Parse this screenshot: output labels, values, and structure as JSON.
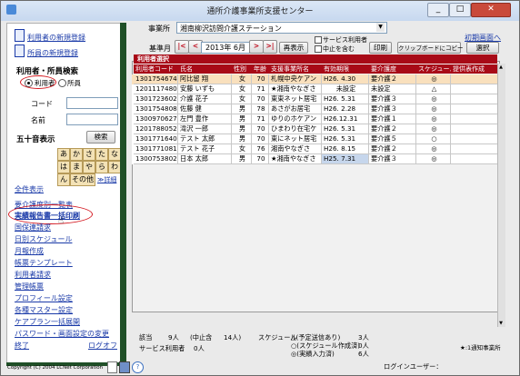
{
  "window": {
    "title": "通所介護事業所支援センター"
  },
  "sidebar": {
    "links": [
      {
        "label": "利用者の新規登録"
      },
      {
        "label": "所員の新規登録"
      }
    ],
    "search_title": "利用者・所員検索",
    "radio_user": "利用者",
    "radio_staff": "所員",
    "code_label": "コード",
    "name_label": "名前",
    "fifty_title": "五十音表示",
    "search_button": "検索",
    "kana": [
      "あ",
      "か",
      "さ",
      "た",
      "な",
      "は",
      "ま",
      "や",
      "ら",
      "わ",
      "ん",
      "その他"
    ],
    "detail_link": "≫詳細",
    "menu": [
      "全件表示",
      "要介護度別一覧表",
      "実績報告書一括印刷",
      "国保連請求",
      "日別スケジュール",
      "月報作成",
      "帳票テンプレート",
      "利用者請求",
      "管理帳票",
      "プロフィール設定",
      "各種マスター設定",
      "ケアプラン一括展開",
      "パスワード・画面設定の変更"
    ],
    "exit": "終了",
    "logout": "ログオフ",
    "copyright": "Copyright (C) 2004 LCNet Corporation"
  },
  "toolbar": {
    "office_label": "事業所",
    "office_value": "湘南柳沢訪問介護ステーション",
    "init_link": "初期画面へ",
    "base_month_label": "基準月",
    "year_month": "2013年 6月",
    "nav_first": "|<",
    "nav_prev": "<",
    "nav_next": ">",
    "nav_last": ">|",
    "reshow": "再表示",
    "service_user": "サービス利用者",
    "include_stop": "中止を含む",
    "print": "印刷",
    "clipboard": "クリップボードにコピー",
    "select": "選択"
  },
  "grid": {
    "title": "利用者選択",
    "columns": [
      "利用者コード",
      "氏名",
      "性別",
      "年齢",
      "支援事業所名",
      "有効期限",
      "要介護度",
      "スケジュール",
      "提供表作成"
    ],
    "rows": [
      [
        "1301754674",
        "阿比留 翔",
        "女",
        "70",
        "札幌中央ケアン",
        "H26. 4.30",
        "要介護２",
        "◎",
        ""
      ],
      [
        "1201117480",
        "安藤 いずも",
        "女",
        "71",
        "★湘南やなぎさ",
        "未設定",
        "未設定",
        "△",
        ""
      ],
      [
        "1301723602",
        "介護 花子",
        "女",
        "70",
        "東東ネット居宅",
        "H26. 5.31",
        "要介護３",
        "◎",
        ""
      ],
      [
        "1301754808",
        "佐藤 健",
        "男",
        "78",
        "あさがお居宅",
        "H26. 2.28",
        "要介護３",
        "◎",
        ""
      ],
      [
        "1300970627",
        "左門 豊作",
        "男",
        "71",
        "ゆりのホケアン",
        "H26.12.31",
        "要介護１",
        "◎",
        ""
      ],
      [
        "1201788052",
        "滝沢 一郎",
        "男",
        "70",
        "ひまわり在宅ケ",
        "H26. 5.31",
        "要介護２",
        "◎",
        ""
      ],
      [
        "1301771640",
        "テスト 太郎",
        "男",
        "70",
        "東にネット居宅",
        "H26. 5.31",
        "要介護５",
        "○",
        ""
      ],
      [
        "1301771081",
        "テスト 花子",
        "女",
        "76",
        "湘南やなぎさ",
        "H26. 8.15",
        "要介護２",
        "◎",
        ""
      ],
      [
        "1300753802",
        "日本 太郎",
        "男",
        "70",
        "★湘南やなぎさ",
        "H25. 7.31",
        "要介護３",
        "◎",
        ""
      ]
    ]
  },
  "status": {
    "count_label": "該当",
    "count_value": "9人",
    "stopped": "(中止含",
    "stopped_value": "14人)",
    "schedule_label": "スケジュール",
    "sched1": "△(予定送信あり)",
    "sched2": "○(スケジュール作成済)",
    "sched3": "◎(実績入力済)",
    "sched1_v": "3人",
    "sched2_v": "0人",
    "sched3_v": "6人",
    "service_user_label": "サービス利用者",
    "service_user_value": "0人",
    "legend": "★:1通知事業所",
    "login": "ログインユーザー："
  },
  "colors": {
    "header_red": "#a80a17",
    "link_blue": "#1a3aa8",
    "sidebar_border": "#1f4f27",
    "highlight": "#f9e0bd",
    "annotation": "#d41820"
  }
}
